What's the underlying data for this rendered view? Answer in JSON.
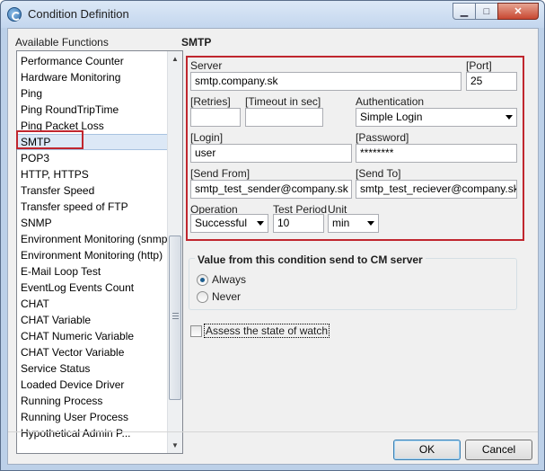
{
  "window": {
    "title": "Condition Definition",
    "minimize_glyph": "▁",
    "maximize_glyph": "□",
    "close_glyph": "✕"
  },
  "sidebar": {
    "label": "Available Functions",
    "selected": "SMTP",
    "items": [
      "Performance Counter",
      "Hardware Monitoring",
      "Ping",
      "Ping RoundTripTime",
      "Ping Packet Loss",
      "SMTP",
      "POP3",
      "HTTP, HTTPS",
      "Transfer Speed",
      "Transfer speed of FTP",
      "SNMP",
      "Environment Monitoring (snmp)",
      "Environment Monitoring (http)",
      "E-Mail Loop Test",
      "EventLog Events Count",
      "CHAT",
      "CHAT Variable",
      "CHAT Numeric Variable",
      "CHAT Vector Variable",
      "Service Status",
      "Loaded Device Driver",
      "Running Process",
      "Running User Process",
      "Hypothetical Admin P..."
    ],
    "scroll_up": "▲",
    "scroll_down": "▼"
  },
  "smtp": {
    "title": "SMTP",
    "server_label": "Server",
    "server_value": "smtp.company.sk",
    "port_label": "[Port]",
    "port_value": "25",
    "retries_label": "[Retries]",
    "retries_value": "",
    "timeout_label": "[Timeout in sec]",
    "timeout_value": "",
    "auth_label": "Authentication",
    "auth_value": "Simple Login",
    "login_label": "[Login]",
    "login_value": "user",
    "password_label": "[Password]",
    "password_value": "********",
    "send_from_label": "[Send From]",
    "send_from_value": "smtp_test_sender@company.sk",
    "send_to_label": "[Send To]",
    "send_to_value": "smtp_test_reciever@company.sk",
    "operation_label": "Operation",
    "operation_value": "Successful",
    "test_period_label": "Test Period",
    "test_period_value": "10",
    "unit_label": "Unit",
    "unit_value": "min"
  },
  "value_group": {
    "title": "Value from this condition send to CM server",
    "options": [
      "Always",
      "Never"
    ],
    "selected": "Always"
  },
  "assess": {
    "label": "Assess the state of watch",
    "checked": false
  },
  "buttons": {
    "ok": "OK",
    "cancel": "Cancel"
  }
}
